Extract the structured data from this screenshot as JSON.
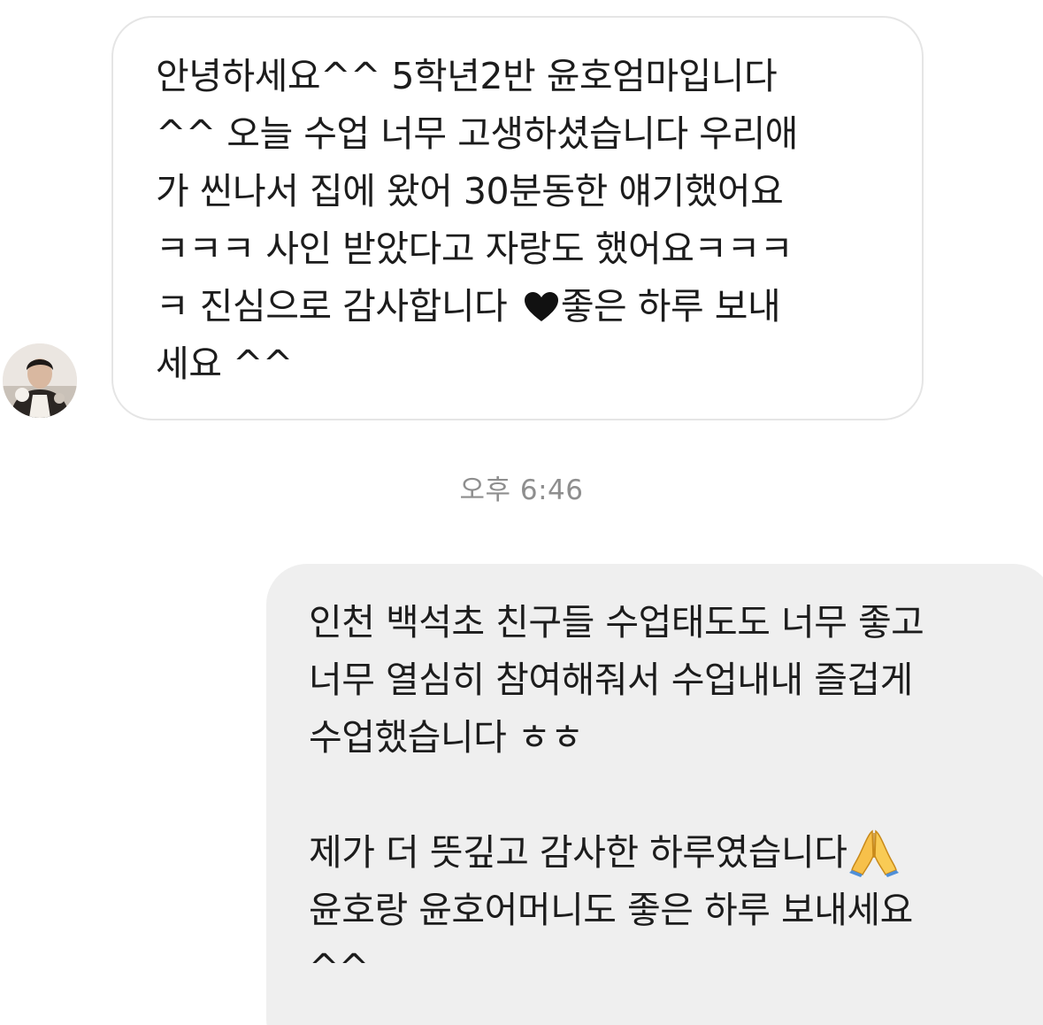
{
  "incoming_message": {
    "lines": [
      "안녕하세요^^ 5학년2반 윤호엄마입니다",
      "^^ 오늘  수업 너무 고생하셨습니다 우리애",
      "가 씬나서 집에 왔어 30분동한 얘기했어요",
      "ㅋㅋㅋ 사인 받았다고 자랑도 했어요ㅋㅋㅋ",
      "세요 ^^"
    ],
    "line5_before_heart": "ㅋ 진심으로 감사합니다 ",
    "line5_after_heart": "좋은 하루 보내"
  },
  "timestamp": "오후 6:46",
  "outgoing_message": {
    "lines": [
      "인천 백석초 친구들 수업태도도 너무 좋고",
      "너무 열심히 참여해줘서 수업내내 즐겁게",
      "수업했습니다 ㅎㅎ",
      "윤호랑 윤호어머니도 좋은 하루 보내세요",
      "^^"
    ],
    "line4_before_emoji": "제가 더 뜻깊고 감사한 하루였습니다"
  },
  "icons": {
    "heart": "black-heart-icon",
    "pray": "folded-hands-emoji-icon",
    "avatar": "profile-avatar"
  }
}
